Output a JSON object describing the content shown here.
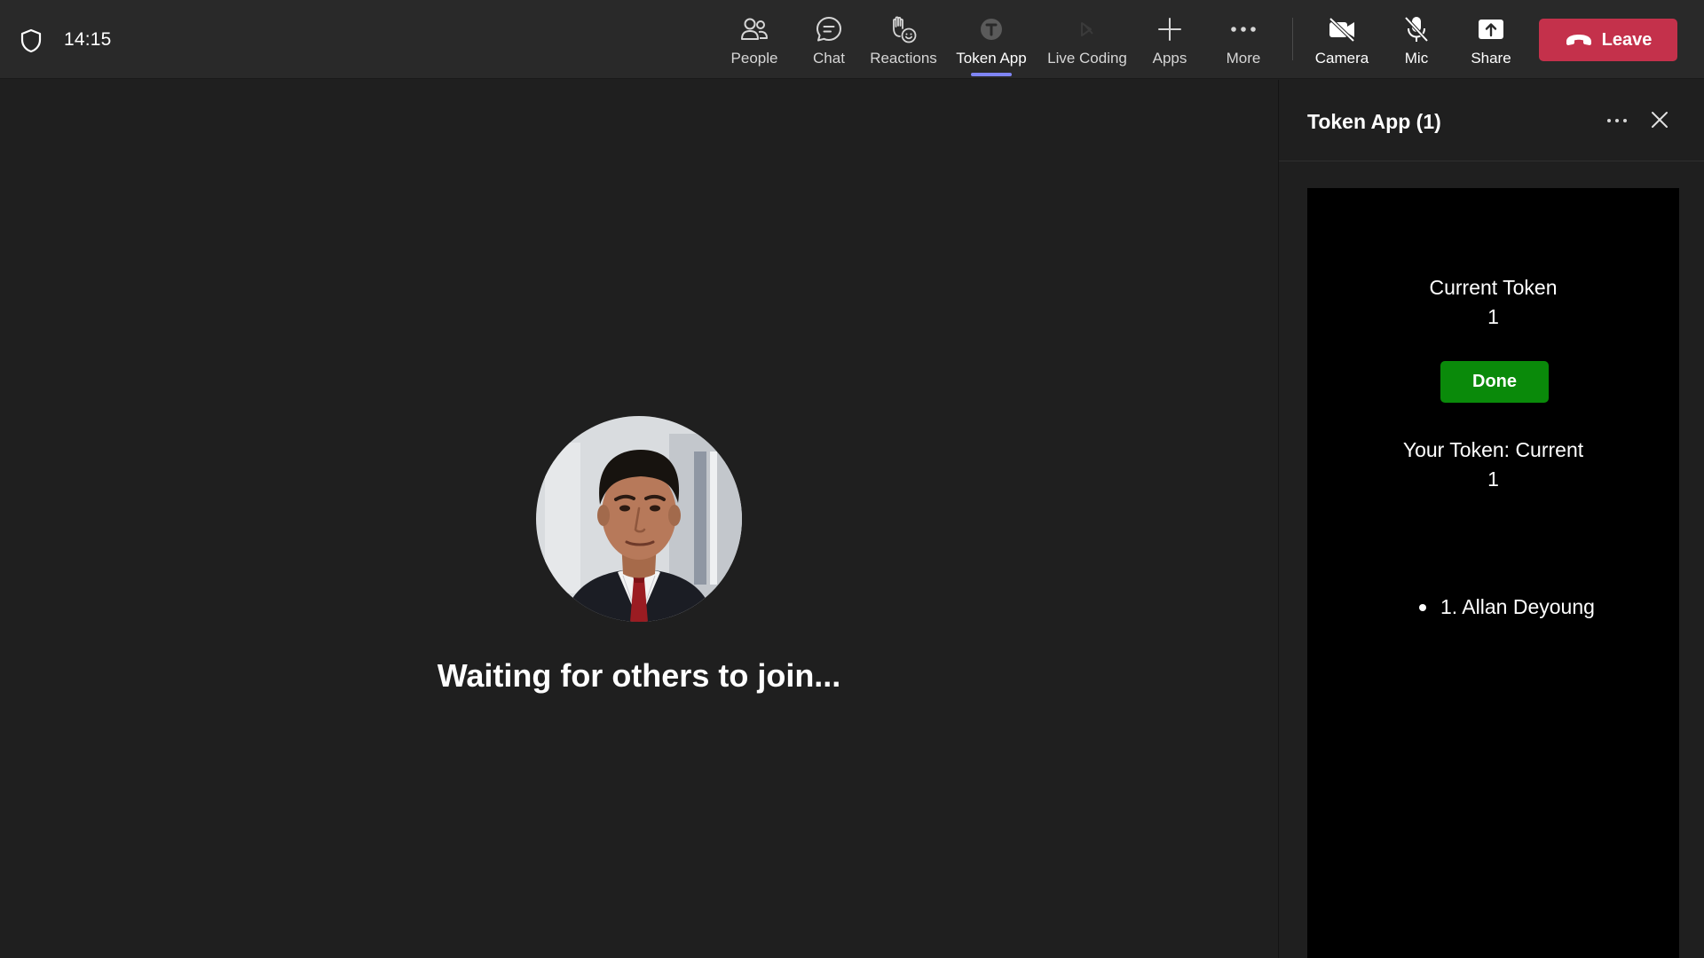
{
  "header": {
    "time": "14:15",
    "tools": [
      {
        "id": "people",
        "label": "People",
        "icon": "people-icon"
      },
      {
        "id": "chat",
        "label": "Chat",
        "icon": "chat-icon"
      },
      {
        "id": "reactions",
        "label": "Reactions",
        "icon": "raise-hand-icon"
      },
      {
        "id": "token",
        "label": "Token App",
        "icon": "token-app-icon",
        "active": true
      },
      {
        "id": "livecoding",
        "label": "Live Coding",
        "icon": "live-coding-icon"
      },
      {
        "id": "apps",
        "label": "Apps",
        "icon": "plus-icon"
      },
      {
        "id": "more",
        "label": "More",
        "icon": "more-dots-icon"
      }
    ],
    "camera_label": "Camera",
    "mic_label": "Mic",
    "share_label": "Share",
    "leave_label": "Leave",
    "accent_color": "#7f85f5",
    "leave_color": "#c4314b"
  },
  "stage": {
    "waiting_text": "Waiting for others to join..."
  },
  "panel": {
    "title": "Token App (1)",
    "current_token_label": "Current Token",
    "current_token_value": "1",
    "done_label": "Done",
    "your_token_label": "Your Token: Current",
    "your_token_value": "1",
    "queue": [
      "1. Allan Deyoung"
    ],
    "done_color": "#0a8a0a"
  }
}
